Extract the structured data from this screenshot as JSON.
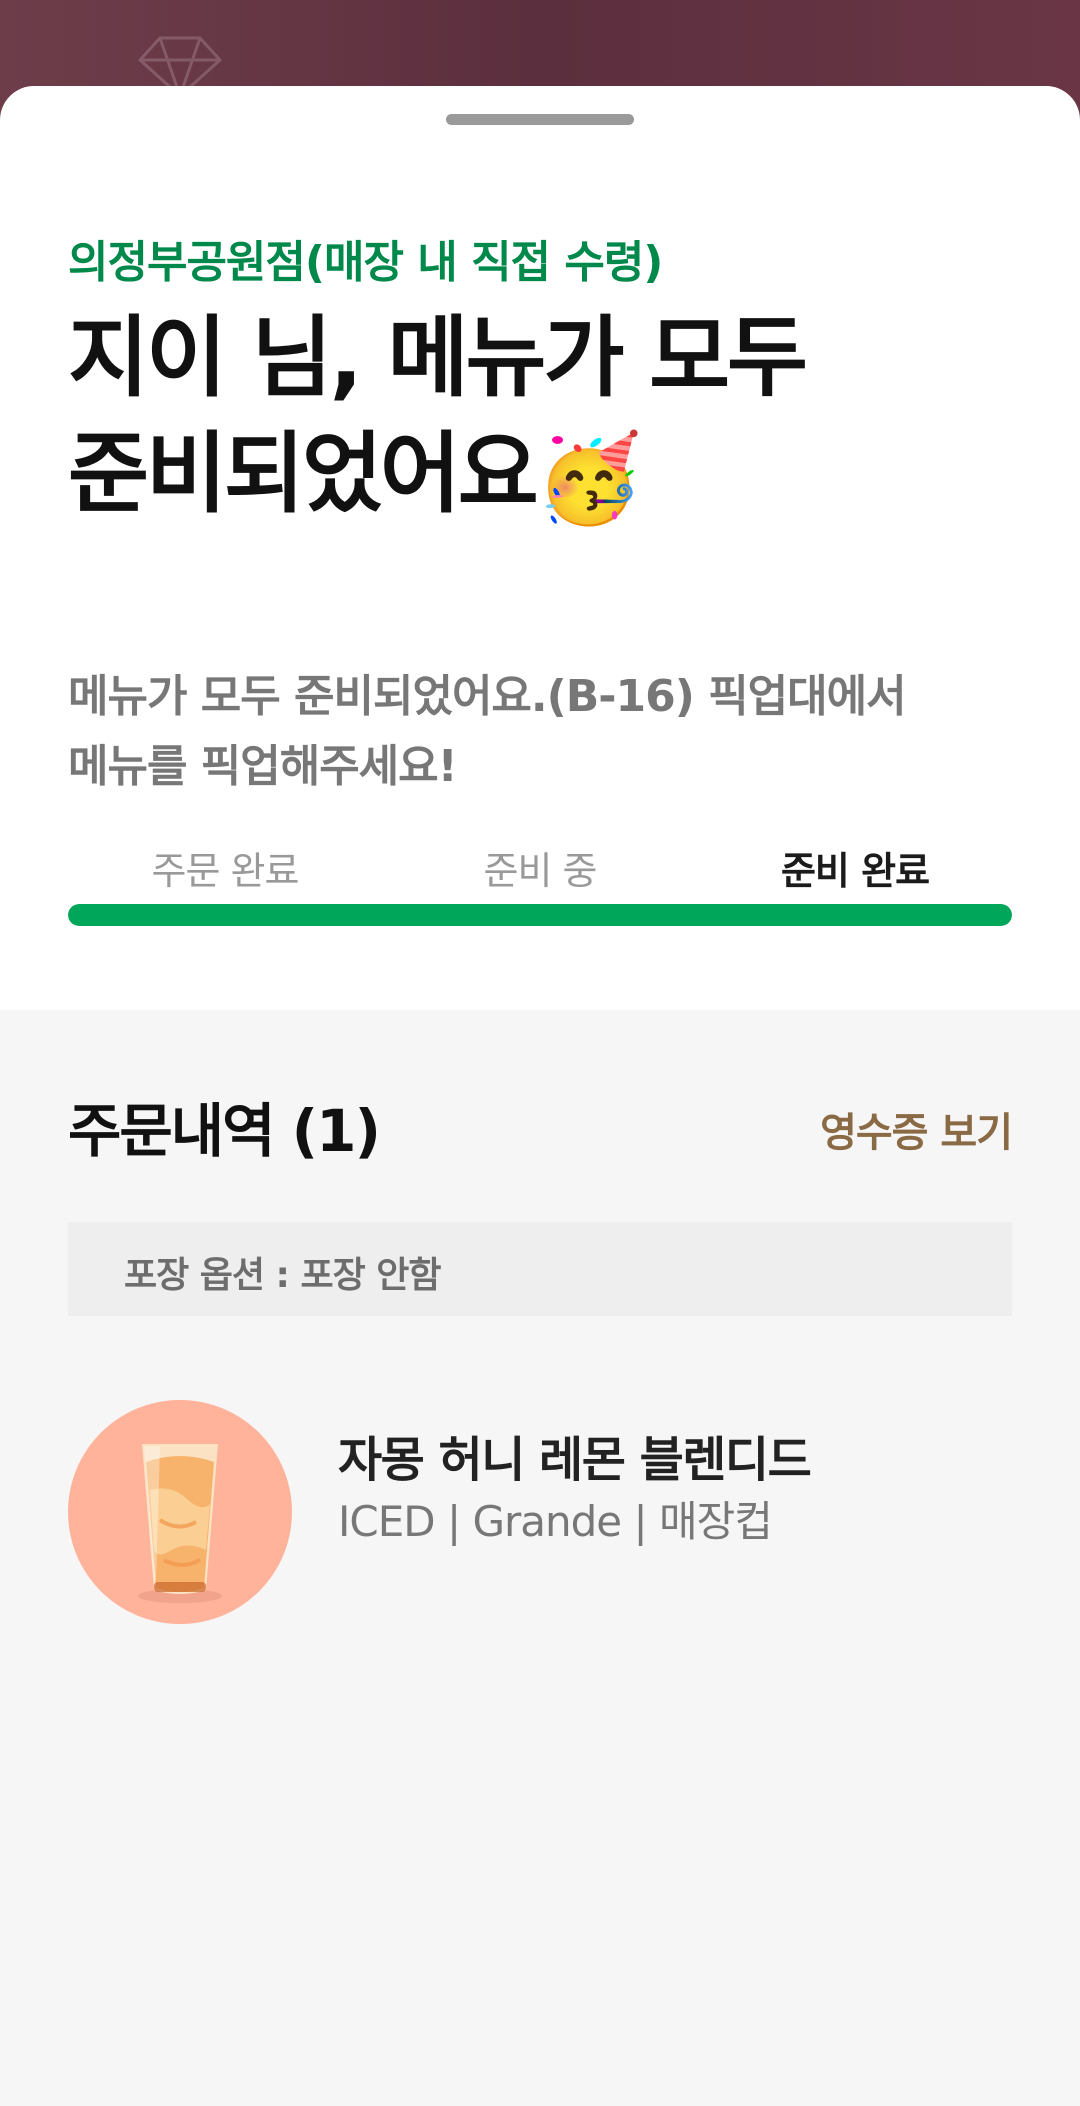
{
  "sheet": {
    "store_label": "의정부공원점(매장 내 직접 수령)",
    "headline_line1": "지이 님, 메뉴가 모두",
    "headline_line2": "준비되었어요",
    "headline_emoji": "🥳",
    "description": "메뉴가 모두 준비되었어요.(B-16)   픽업대에서\n메뉴를 픽업해주세요!",
    "steps": [
      {
        "label": "주문 완료",
        "active": false
      },
      {
        "label": "준비 중",
        "active": false
      },
      {
        "label": "준비 완료",
        "active": true
      }
    ],
    "progress_percent": 100,
    "accent_color": "#00a65a"
  },
  "order": {
    "title": "주문내역 (1)",
    "receipt_link": "영수증 보기",
    "packaging_option": "포장 옵션 : 포장 안함",
    "items": [
      {
        "name": "자몽 허니 레몬 블렌디드",
        "options": "ICED | Grande | 매장컵",
        "image_icon": "grapefruit-blended-drink-icon"
      }
    ]
  }
}
